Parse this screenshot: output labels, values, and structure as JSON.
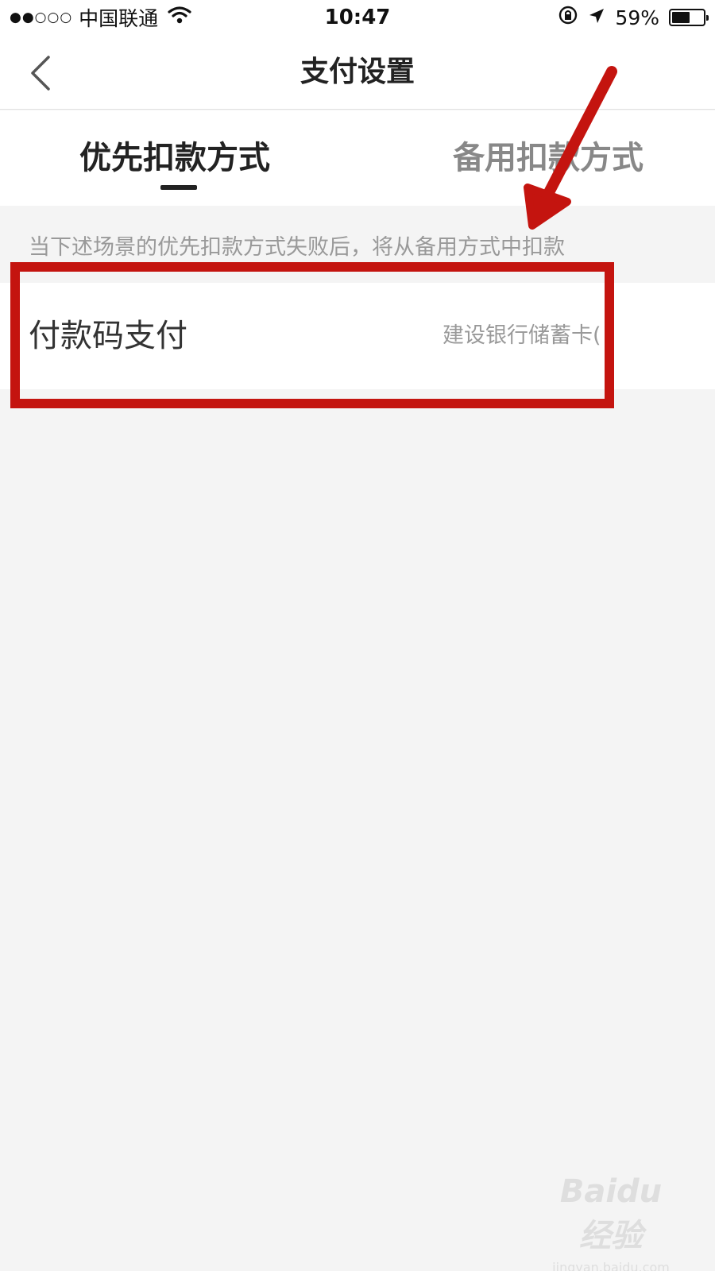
{
  "status_bar": {
    "signal": "●●○○○",
    "carrier": "中国联通",
    "time": "10:47",
    "battery_text": "59%",
    "battery_level": 0.59
  },
  "nav": {
    "title": "支付设置"
  },
  "tabs": [
    {
      "label": "优先扣款方式",
      "active": true
    },
    {
      "label": "备用扣款方式",
      "active": false
    }
  ],
  "description": "当下述场景的优先扣款方式失败后，将从备用方式中扣款",
  "rows": [
    {
      "label": "付款码支付",
      "value": "建设银行储蓄卡("
    }
  ],
  "watermark": {
    "brand": "Baidu 经验",
    "url": "jingyan.baidu.com"
  },
  "colors": {
    "annotation": "#c4140f",
    "background": "#f4f4f4"
  }
}
